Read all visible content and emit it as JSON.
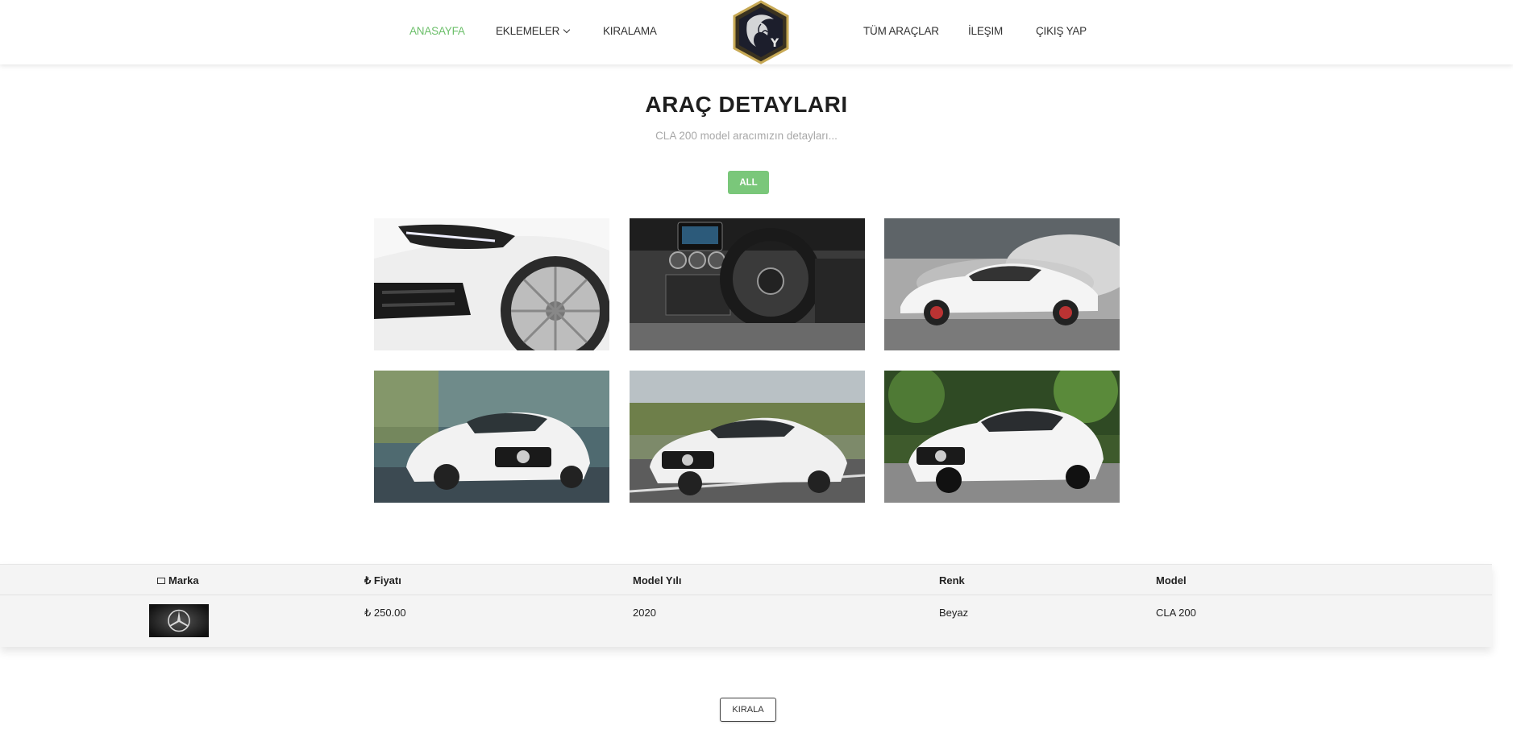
{
  "nav": {
    "items": [
      {
        "label": "ANASAYFA",
        "active": true
      },
      {
        "label": "EKLEMELER",
        "dropdown": true
      },
      {
        "label": "KIRALAMA"
      },
      {
        "label": "TÜM ARAÇLAR"
      },
      {
        "label": "İLEŞIM"
      },
      {
        "label": "ÇIKIŞ YAP"
      }
    ],
    "logo_letter": "Y"
  },
  "header": {
    "title": "ARAÇ DETAYLARI",
    "subtitle": "CLA 200 model aracımızın detayları..."
  },
  "filter": {
    "label": "ALL"
  },
  "gallery": {
    "images": [
      "front-wheel-closeup",
      "interior-dashboard",
      "side-profile-smoke",
      "front-three-quarter-track",
      "front-road-motion",
      "front-three-quarter-park"
    ]
  },
  "table": {
    "headers": {
      "brand": "Marka",
      "price": "Fiyatı",
      "year": "Model Yılı",
      "color": "Renk",
      "model": "Model"
    },
    "row": {
      "price": "₺ 250.00",
      "year": "2020",
      "color": "Beyaz",
      "model": "CLA 200"
    }
  },
  "actions": {
    "rent_label": "KIRALA"
  },
  "colors": {
    "accent": "#6cbf6a",
    "filter_button": "#7ac77a"
  }
}
